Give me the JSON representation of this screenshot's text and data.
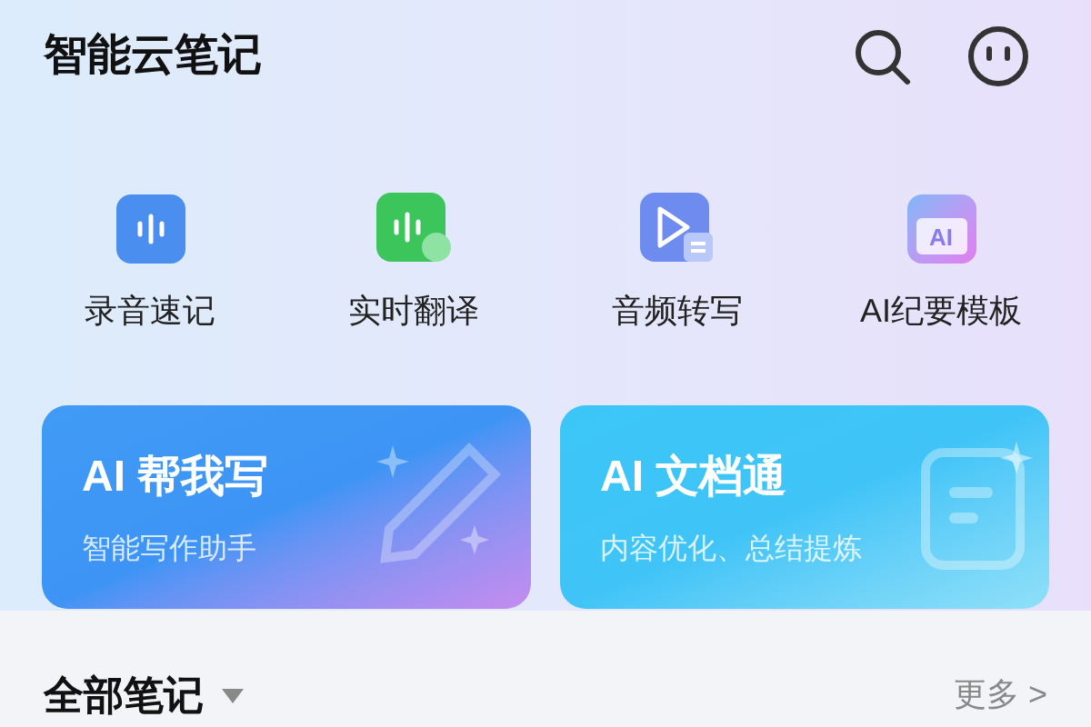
{
  "header": {
    "title": "智能云笔记"
  },
  "quick_actions": [
    {
      "kind": "record",
      "label": "录音速记"
    },
    {
      "kind": "translate",
      "label": "实时翻译"
    },
    {
      "kind": "transcribe",
      "label": "音频转写"
    },
    {
      "kind": "template",
      "label": "AI纪要模板",
      "icon_text": "AI"
    }
  ],
  "cards": [
    {
      "kind": "write",
      "title": "AI 帮我写",
      "subtitle": "智能写作助手"
    },
    {
      "kind": "document",
      "title": "AI 文档通",
      "subtitle": "内容优化、总结提炼"
    }
  ],
  "notes_section": {
    "title": "全部笔记",
    "more": "更多 >"
  }
}
